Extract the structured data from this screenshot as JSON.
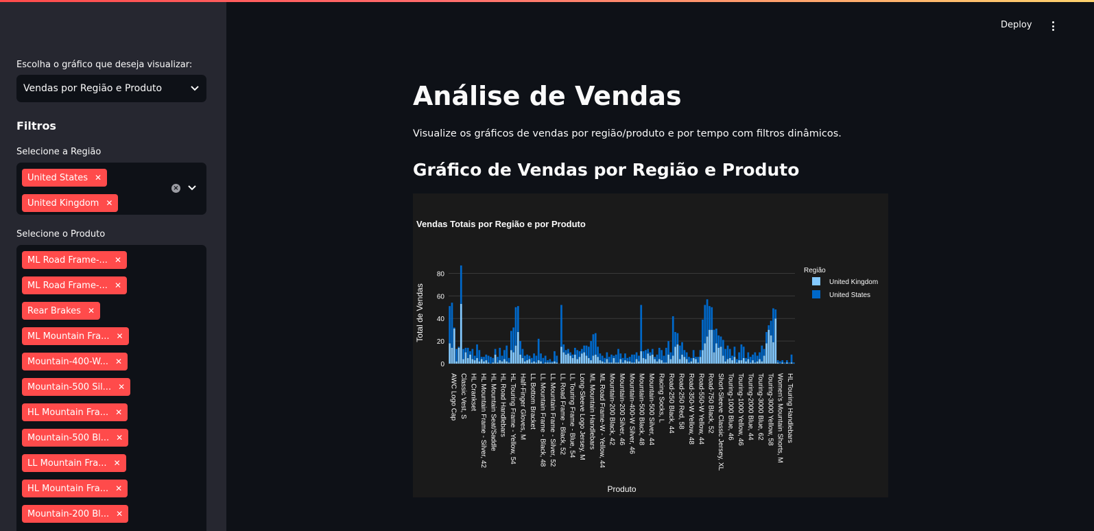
{
  "app": {
    "deploy_label": "Deploy",
    "accent": "#ff4b4b"
  },
  "sidebar": {
    "chart_select_label": "Escolha o gráfico que deseja visualizar:",
    "chart_select_value": "Vendas por Região e Produto",
    "filters_heading": "Filtros",
    "region_label": "Selecione a Região",
    "region_tags": [
      "United States",
      "United Kingdom"
    ],
    "product_label": "Selecione o Produto",
    "product_tags": [
      "ML Road Frame-...",
      "ML Road Frame-...",
      "Rear Brakes",
      "ML Mountain Fra...",
      "Mountain-400-W...",
      "Mountain-500 Sil...",
      "HL Mountain Fra...",
      "Mountain-500 Bl...",
      "LL Mountain Fra...",
      "HL Mountain Fra...",
      "Mountain-200 Bl..."
    ]
  },
  "main": {
    "title": "Análise de Vendas",
    "subtitle": "Visualize os gráficos de vendas por região/produto e por tempo com filtros dinâmicos.",
    "section_title": "Gráfico de Vendas por Região e Produto"
  },
  "chart_data": {
    "type": "bar",
    "title": "Vendas Totais por Região e por Produto",
    "xlabel": "Produto",
    "ylabel": "Total de Vendas",
    "legend_title": "Região",
    "legend_position": "top-right",
    "ylim": [
      0,
      90
    ],
    "yticks": [
      0,
      20,
      40,
      60,
      80
    ],
    "grid": true,
    "stacked": true,
    "tick_labels": [
      "AWC Logo Cap",
      "Classic Vest, S",
      "HL Crankset",
      "HL Mountain Frame - Silver, 42",
      "HL Mountain Seat/Saddle",
      "HL Road Handlebars",
      "HL Touring Frame - Yellow, 54",
      "Half-Finger Gloves, M",
      "LL Bottom Bracket",
      "LL Mountain Frame - Black, 48",
      "LL Mountain Frame - Silver, 52",
      "LL Road Frame - Black, 52",
      "LL Touring Frame - Blue, 54",
      "Long-Sleeve Logo Jersey, M",
      "ML Mountain Handlebars",
      "ML Road Frame-W - Yellow, 44",
      "Mountain-200 Black, 42",
      "Mountain-200 Silver, 46",
      "Mountain-400-W Silver, 46",
      "Mountain-500 Black, 48",
      "Mountain-500 Silver, 44",
      "Racing Socks, L",
      "Road-250 Black, 44",
      "Road-250 Red, 58",
      "Road-350-W Yellow, 48",
      "Road-550-W Yellow, 44",
      "Road-750 Black, 52",
      "Short-Sleeve Classic Jersey, XL",
      "Touring-1000 Blue, 46",
      "Touring-1000 Yellow, 46",
      "Touring-2000 Blue, 44",
      "Touring-3000 Blue, 62",
      "Touring-3000 Yellow, 58",
      "Women's Mountain Shorts, M",
      "HL Touring Handlebars"
    ],
    "series": [
      {
        "name": "United Kingdom",
        "color": "#83c9ff",
        "values": [
          18,
          14,
          31,
          2,
          14,
          53,
          4,
          10,
          5,
          8,
          4,
          3,
          5,
          2,
          4,
          2,
          3,
          1,
          0,
          1,
          8,
          1,
          3,
          2,
          4,
          2,
          1,
          12,
          10,
          16,
          28,
          8,
          5,
          2,
          3,
          4,
          1,
          2,
          1,
          3,
          2,
          0,
          1,
          1,
          1,
          1,
          2,
          1,
          0,
          15,
          10,
          8,
          9,
          7,
          5,
          8,
          4,
          6,
          9,
          10,
          7,
          5,
          3,
          7,
          8,
          6,
          3,
          2,
          1,
          4,
          1,
          1,
          5,
          1,
          1,
          4,
          1,
          3,
          2,
          2,
          1,
          1,
          4,
          2,
          11,
          5,
          4,
          9,
          7,
          8,
          4,
          2,
          4,
          3,
          1,
          1,
          8,
          4,
          7,
          15,
          17,
          4,
          8,
          6,
          4,
          1,
          2,
          5,
          4,
          1,
          6,
          12,
          18,
          24,
          30,
          30,
          10,
          18,
          14,
          15,
          7,
          2,
          4,
          5,
          3,
          6,
          1,
          3,
          3,
          5,
          2,
          4,
          1,
          3,
          1,
          2,
          4,
          2,
          7,
          18,
          30,
          25,
          19,
          40,
          1,
          0,
          1,
          0,
          1,
          0,
          1,
          0
        ]
      },
      {
        "name": "United States",
        "color": "#0068c9",
        "values": [
          33,
          40,
          1,
          11,
          1,
          34,
          9,
          4,
          9,
          3,
          9,
          4,
          12,
          10,
          2,
          4,
          5,
          6,
          6,
          4,
          5,
          5,
          11,
          5,
          8,
          14,
          4,
          17,
          22,
          34,
          23,
          12,
          8,
          5,
          5,
          3,
          4,
          7,
          6,
          19,
          7,
          5,
          6,
          2,
          3,
          1,
          9,
          6,
          0,
          37,
          7,
          4,
          4,
          3,
          3,
          6,
          8,
          5,
          4,
          6,
          9,
          10,
          17,
          19,
          19,
          9,
          6,
          5,
          4,
          6,
          5,
          7,
          2,
          7,
          12,
          5,
          4,
          6,
          3,
          4,
          7,
          7,
          6,
          5,
          41,
          6,
          8,
          4,
          3,
          5,
          2,
          6,
          10,
          9,
          6,
          13,
          12,
          6,
          35,
          13,
          10,
          12,
          11,
          6,
          6,
          5,
          3,
          7,
          2,
          5,
          6,
          27,
          34,
          33,
          21,
          20,
          20,
          13,
          11,
          9,
          14,
          11,
          12,
          8,
          4,
          9,
          3,
          7,
          14,
          10,
          3,
          6,
          5,
          5,
          9,
          5,
          6,
          14,
          6,
          10,
          4,
          13,
          30,
          8,
          2,
          2,
          2,
          1,
          2,
          1,
          7,
          1
        ]
      }
    ]
  }
}
